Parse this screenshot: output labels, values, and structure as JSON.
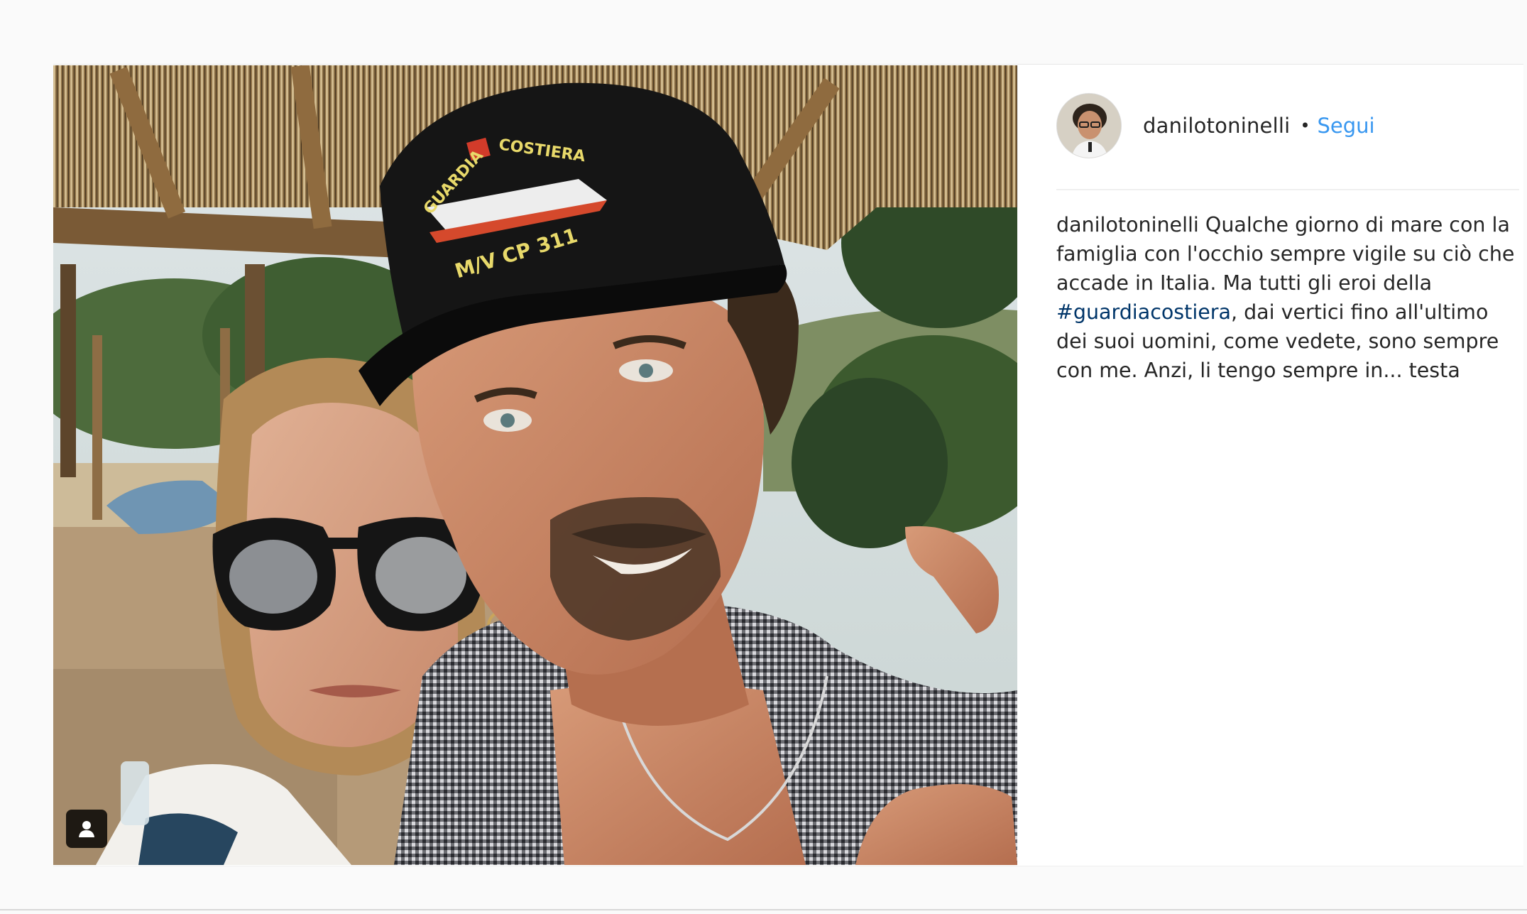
{
  "post": {
    "username": "danilotoninelli",
    "separator": "•",
    "follow_label": "Segui",
    "caption": {
      "author": "danilotoninelli",
      "text_before": " Qualche giorno di mare con la famiglia con l'occhio sempre vigile su ciò che accade in Italia. Ma tutti gli eroi della ",
      "hashtag": "#guardiacostiera",
      "text_after": ", dai vertici fino all'ultimo dei suoi uomini, come vedete, sono sempre con me. Anzi, li tengo sempre in... testa"
    },
    "photo": {
      "cap_text_top": "GUARDIA",
      "cap_text_costiera": "COSTIERA",
      "cap_text_vessel": "M/V CP 311"
    },
    "icons": {
      "tag": "person-tag-icon",
      "avatar": "profile-avatar"
    }
  },
  "colors": {
    "link": "#3897f0",
    "hashtag": "#003569",
    "text": "#262626"
  }
}
